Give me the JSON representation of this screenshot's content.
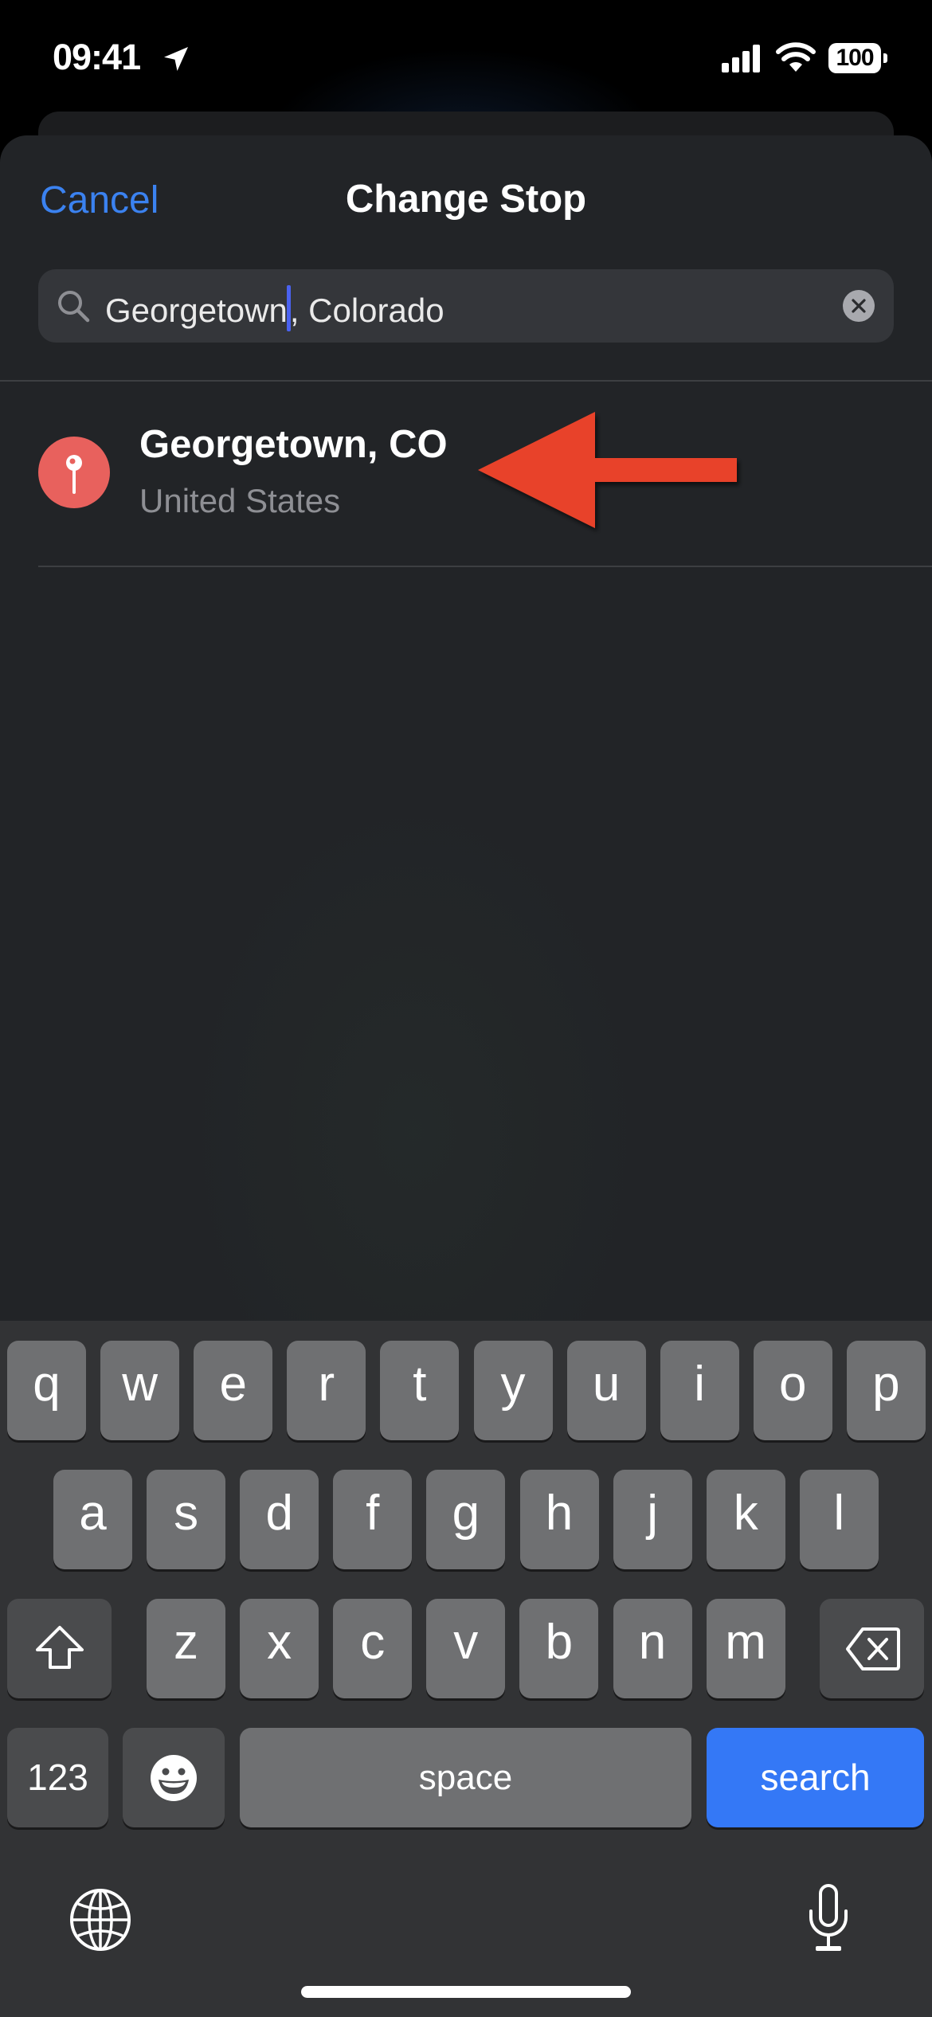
{
  "status_bar": {
    "time": "09:41",
    "battery_percent": "100",
    "icons": [
      "location-arrow-icon",
      "cellular-signal-icon",
      "wifi-icon",
      "battery-icon"
    ]
  },
  "nav": {
    "cancel_label": "Cancel",
    "title": "Change Stop"
  },
  "search": {
    "value_before_caret": "Georgetown",
    "value_after_caret": ", Colorado",
    "value": "Georgetown, Colorado",
    "icon": "magnifying-glass-icon",
    "clear_icon": "clear-x-icon"
  },
  "results": [
    {
      "title": "Georgetown, CO",
      "subtitle": "United States",
      "icon": "map-pin-icon",
      "icon_color": "#e8615d"
    }
  ],
  "annotation": {
    "type": "arrow",
    "direction": "left",
    "color": "#e8432a",
    "points_to": "Georgetown, CO"
  },
  "keyboard": {
    "row1": [
      "q",
      "w",
      "e",
      "r",
      "t",
      "y",
      "u",
      "i",
      "o",
      "p"
    ],
    "row2": [
      "a",
      "s",
      "d",
      "f",
      "g",
      "h",
      "j",
      "k",
      "l"
    ],
    "row3": [
      "z",
      "x",
      "c",
      "v",
      "b",
      "n",
      "m"
    ],
    "shift_icon": "shift-arrow-icon",
    "delete_icon": "backspace-icon",
    "numbers_label": "123",
    "emoji_icon": "emoji-icon",
    "space_label": "space",
    "return_label": "search",
    "return_color": "#3478f6",
    "globe_icon": "globe-icon",
    "mic_icon": "microphone-icon"
  },
  "colors": {
    "accent": "#3b82f0",
    "sheet_bg": "#222427",
    "key_bg": "#6f7072",
    "key_dark_bg": "#4a4b4d"
  }
}
